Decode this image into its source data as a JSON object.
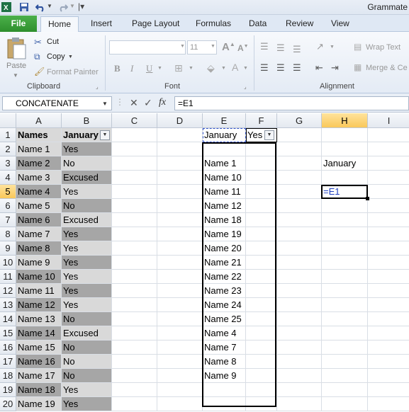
{
  "app": {
    "title": "Grammate",
    "tabs": [
      "File",
      "Home",
      "Insert",
      "Page Layout",
      "Formulas",
      "Data",
      "Review",
      "View"
    ],
    "active_tab": "Home"
  },
  "ribbon": {
    "clipboard": {
      "paste": "Paste",
      "cut": "Cut",
      "copy": "Copy",
      "format_painter": "Format Painter",
      "label": "Clipboard"
    },
    "font": {
      "font_name": "",
      "font_size": "11",
      "bold": "B",
      "italic": "I",
      "underline": "U",
      "label": "Font"
    },
    "alignment": {
      "wrap_text": "Wrap Text",
      "merge": "Merge & Ce",
      "label": "Alignment"
    }
  },
  "formula_bar": {
    "name_box": "CONCATENATE",
    "formula": "=E1"
  },
  "columns": [
    "A",
    "B",
    "C",
    "D",
    "E",
    "F",
    "G",
    "H",
    "I"
  ],
  "rows": [
    "1",
    "2",
    "3",
    "4",
    "5",
    "6",
    "7",
    "8",
    "9",
    "10",
    "11",
    "12",
    "13",
    "14",
    "15",
    "16",
    "17",
    "18",
    "19",
    "20"
  ],
  "table_ab": {
    "headers": [
      "Names",
      "January"
    ],
    "names": [
      "Name 1",
      "Name 2",
      "Name 3",
      "Name 4",
      "Name 5",
      "Name 6",
      "Name 7",
      "Name 8",
      "Name 9",
      "Name 10",
      "Name 11",
      "Name 12",
      "Name 13",
      "Name 14",
      "Name 15",
      "Name 16",
      "Name 17",
      "Name 18",
      "Name 19"
    ],
    "values": [
      "Yes",
      "No",
      "Excused",
      "Yes",
      "No",
      "Excused",
      "Yes",
      "Yes",
      "Yes",
      "Yes",
      "Yes",
      "Yes",
      "No",
      "Excused",
      "No",
      "No",
      "No",
      "Yes",
      "Yes"
    ]
  },
  "table_ef": {
    "header_e": "January",
    "header_f": "Yes",
    "names": [
      "Name 1",
      "Name 10",
      "Name 11",
      "Name 12",
      "Name 18",
      "Name 19",
      "Name 20",
      "Name 21",
      "Name 22",
      "Name 23",
      "Name 24",
      "Name 25",
      "Name 4",
      "Name 7",
      "Name 8",
      "Name 9"
    ]
  },
  "cell_h3": "January",
  "cell_h5": "=E1",
  "colors": {
    "file_tab": "#2e8f2d",
    "selection_border": "#000000",
    "formula_ref": "#1f3fbf"
  }
}
